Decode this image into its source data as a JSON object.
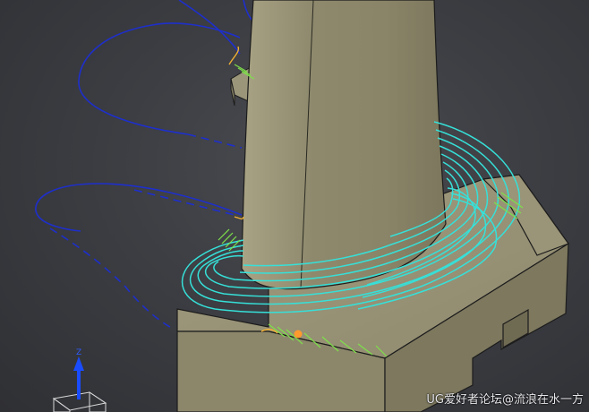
{
  "viewport": {
    "background_color": "#3c3e43",
    "part_color": "#8f8a6e",
    "toolpath_color": "#36e0d8",
    "engage_color": "#7ee04a",
    "rapid_color": "#1e2fcc",
    "marker_color": "#ff9a2e"
  },
  "triad": {
    "axis_label": "Z",
    "axis_color": "#1a4cff"
  },
  "watermark": {
    "text": "UG爱好者论坛@流浪在水一方"
  }
}
